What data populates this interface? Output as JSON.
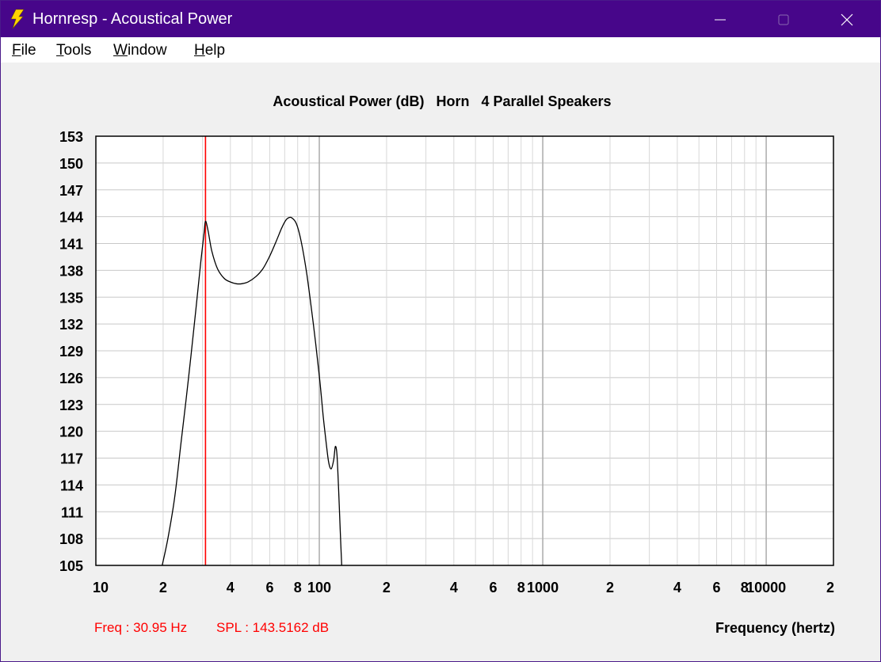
{
  "window": {
    "title": "Hornresp - Acoustical Power",
    "controls": [
      "minimize",
      "maximize",
      "close"
    ]
  },
  "menu": [
    {
      "label": "File",
      "accel": "F"
    },
    {
      "label": "Tools",
      "accel": "T"
    },
    {
      "label": "Window",
      "accel": "W"
    },
    {
      "label": "Help",
      "accel": "H"
    }
  ],
  "readout": {
    "freq": "Freq : 30.95 Hz",
    "spl": "SPL : 143.5162 dB",
    "color": "#ff0000"
  },
  "chart_data": {
    "type": "line",
    "title": "Acoustical Power (dB)   Horn   4 Parallel Speakers",
    "xlabel": "Frequency (hertz)",
    "ylabel": "",
    "x_scale": "log",
    "xlim": [
      10,
      20000
    ],
    "ylim": [
      105,
      153
    ],
    "y_ticks": [
      153,
      150,
      147,
      144,
      141,
      138,
      135,
      132,
      129,
      126,
      123,
      120,
      117,
      114,
      111,
      108,
      105
    ],
    "x_tick_labels": [
      {
        "value": 10,
        "label": "10"
      },
      {
        "value": 20,
        "label": "2"
      },
      {
        "value": 40,
        "label": "4"
      },
      {
        "value": 60,
        "label": "6"
      },
      {
        "value": 80,
        "label": "8"
      },
      {
        "value": 100,
        "label": "100"
      },
      {
        "value": 200,
        "label": "2"
      },
      {
        "value": 400,
        "label": "4"
      },
      {
        "value": 600,
        "label": "6"
      },
      {
        "value": 800,
        "label": "8"
      },
      {
        "value": 1000,
        "label": "1000"
      },
      {
        "value": 2000,
        "label": "2"
      },
      {
        "value": 4000,
        "label": "4"
      },
      {
        "value": 6000,
        "label": "6"
      },
      {
        "value": 8000,
        "label": "8"
      },
      {
        "value": 10000,
        "label": "10000"
      },
      {
        "value": 20000,
        "label": "2"
      }
    ],
    "grid": true,
    "marker": {
      "x": 30.95,
      "color": "#ff0000"
    },
    "series": [
      {
        "color": "#000000",
        "x": [
          19.8,
          21,
          22.5,
          24,
          26,
          28,
          29.5,
          30.5,
          30.95,
          31.8,
          33,
          35,
          37.5,
          40,
          42.5,
          45,
          48,
          52,
          56,
          60,
          64,
          67.5,
          70,
          72,
          75,
          79,
          83,
          88,
          94,
          100,
          104,
          107,
          110,
          113,
          116,
          118,
          120,
          122,
          124,
          126
        ],
        "y": [
          105,
          108,
          112.5,
          118.5,
          126,
          133.5,
          139,
          142.2,
          143.5,
          142.4,
          140.2,
          138.2,
          137.1,
          136.7,
          136.5,
          136.5,
          136.7,
          137.3,
          138.2,
          139.6,
          141.2,
          142.6,
          143.4,
          143.8,
          143.9,
          143.2,
          141.2,
          137.5,
          132,
          126.2,
          121.8,
          119,
          116.6,
          115.8,
          116.8,
          118.3,
          117.3,
          113.5,
          109,
          105
        ]
      }
    ]
  }
}
